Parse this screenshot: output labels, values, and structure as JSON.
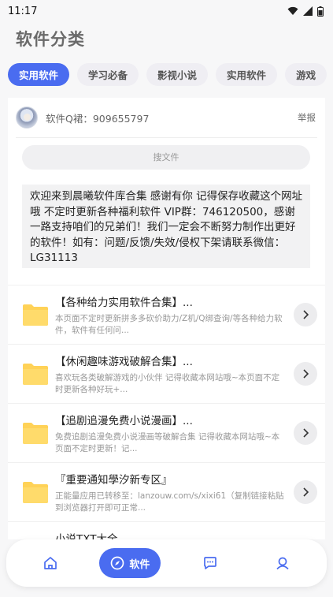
{
  "status_bar": {
    "time": "11:17"
  },
  "page": {
    "title": "软件分类"
  },
  "tabs": [
    {
      "label": "实用软件",
      "active": true
    },
    {
      "label": "学习必备",
      "active": false
    },
    {
      "label": "影视小说",
      "active": false
    },
    {
      "label": "实用软件",
      "active": false
    },
    {
      "label": "游戏",
      "active": false
    }
  ],
  "group_info": {
    "label": "软件Q裙：909655797",
    "report": "举报"
  },
  "search": {
    "placeholder": "搜文件"
  },
  "notice": {
    "text": "欢迎来到晨曦软件库合集 感谢有你 记得保存收藏这个网址哦 不定时更新各种福利软件 VIP群：746120500，感谢一路支持咱们的兄弟们！我们一定会不断努力制作出更好的软件！如有：问题/反馈/失效/侵权下架请联系微信：LG31113"
  },
  "list": [
    {
      "title": "【各种给力实用软件合集】...",
      "desc": "本页面不定时更新拼多多砍价助力/Z机/Q绑查询/等各种给力软件，软件有任何问..."
    },
    {
      "title": "【休闲趣味游戏破解合集】...",
      "desc": "喜欢玩各类破解游戏的小伙伴 记得收藏本网站哦~本页面不定时更新各种好玩+..."
    },
    {
      "title": "【追剧追漫免费小说漫画】...",
      "desc": "免费追剧追漫免费小说漫画等破解合集 记得收藏本网站哦~本页面不定时更新！记..."
    },
    {
      "title": "『重要通知學汐新专区』",
      "desc": "正能量应用已转移至：lanzouw.com/s/xixi61（复制链接粘贴到浏览器打开即可正常..."
    },
    {
      "title": "小说TXT大全",
      "desc": ""
    }
  ],
  "bottom_nav": {
    "active_label": "软件"
  },
  "colors": {
    "accent": "#4a6cf0",
    "folder": "#ffd257"
  }
}
